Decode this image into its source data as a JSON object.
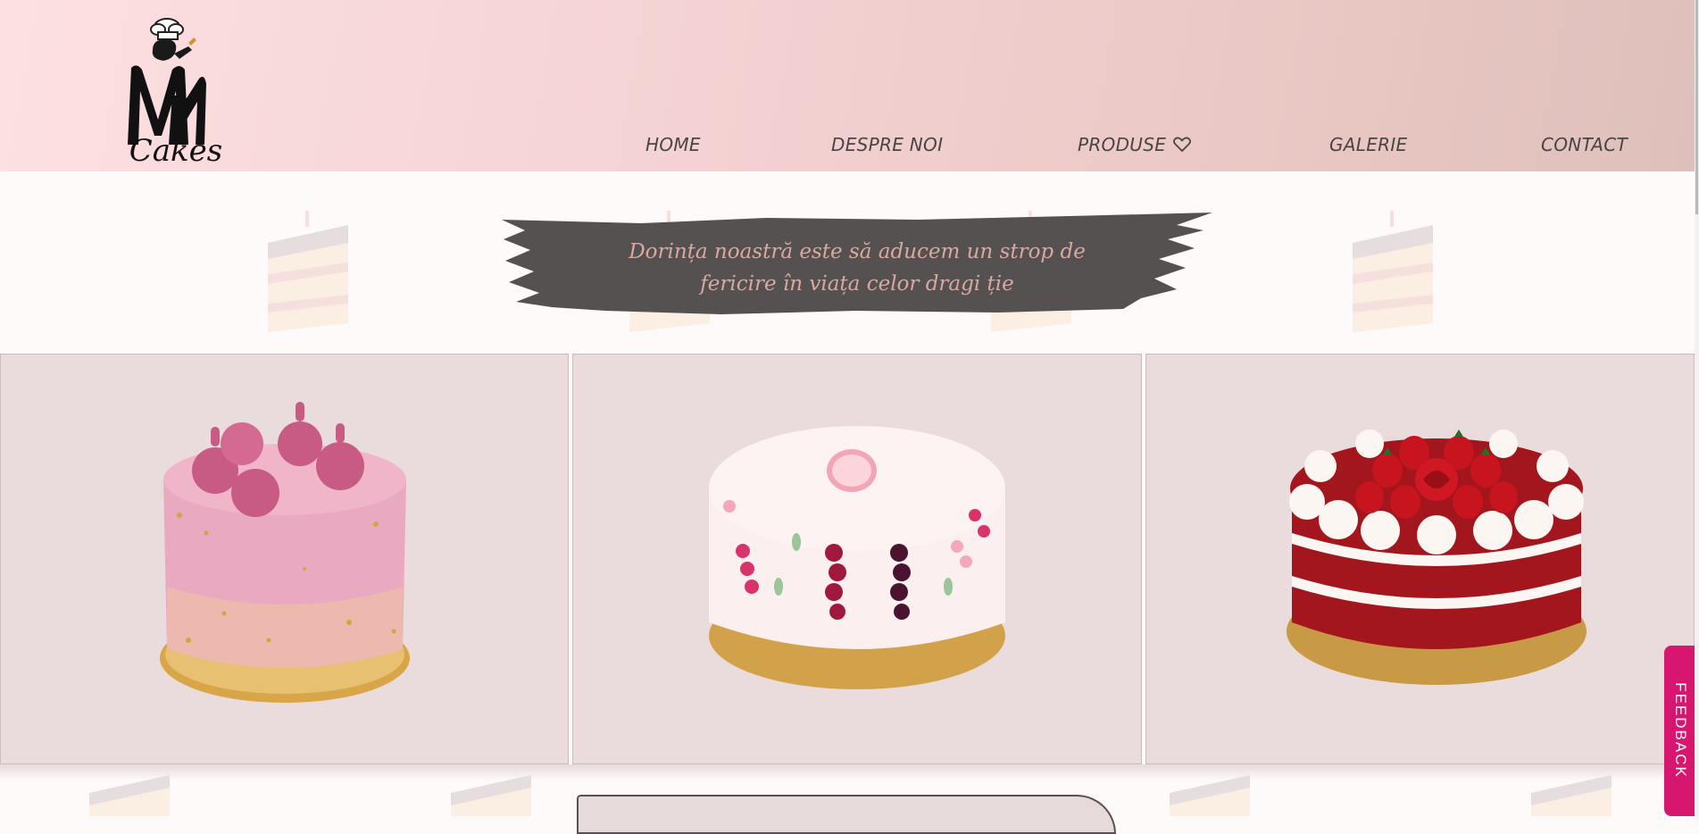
{
  "brand": {
    "logo_alt": "M Cakes"
  },
  "nav": {
    "home": "HOME",
    "about": "DESPRE NOI",
    "products": "PRODUSE",
    "gallery": "GALERIE",
    "contact": "CONTACT"
  },
  "hero": {
    "tagline_line1": "Dorința noastră este să aducem un strop de",
    "tagline_line2": "fericire în viața celor dragi ție"
  },
  "cards": [
    {
      "name": "pink-sprinkle-cake"
    },
    {
      "name": "floral-fondant-cake"
    },
    {
      "name": "red-velvet-strawberry-cake"
    }
  ],
  "feedback": {
    "label": "FEEDBACK"
  },
  "colors": {
    "header_start": "#fde0e2",
    "header_end": "#dec0bb",
    "brush": "#565151",
    "tagline": "#d9a9a0",
    "card_bg": "#eadcdc",
    "feedback": "#d6166f"
  }
}
